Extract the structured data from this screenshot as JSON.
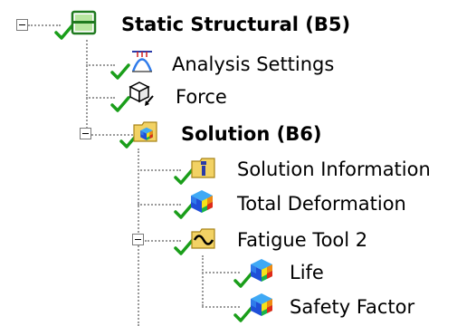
{
  "tree": {
    "static_structural": {
      "label": "Static Structural (B5)",
      "expanded": true,
      "status": "ok"
    },
    "analysis_settings": {
      "label": "Analysis Settings",
      "status": "ok"
    },
    "force": {
      "label": "Force",
      "status": "ok"
    },
    "solution": {
      "label": "Solution (B6)",
      "expanded": true,
      "status": "ok"
    },
    "solution_information": {
      "label": "Solution Information",
      "status": "ok"
    },
    "total_deformation": {
      "label": "Total Deformation",
      "status": "ok"
    },
    "fatigue_tool": {
      "label": "Fatigue Tool 2",
      "expanded": true,
      "status": "ok"
    },
    "life": {
      "label": "Life",
      "status": "ok"
    },
    "safety_factor": {
      "label": "Safety Factor",
      "status": "ok"
    }
  },
  "icons": {
    "check": "green-checkmark-icon",
    "static_structural": "static-structural-icon",
    "analysis_settings": "analysis-settings-icon",
    "force": "force-icon",
    "solution": "solution-folder-icon",
    "solution_information": "solution-information-icon",
    "result": "result-cube-icon",
    "fatigue_tool": "fatigue-tool-icon"
  },
  "colors": {
    "check": "#1a9e1a",
    "folder": "#f2d264",
    "connector": "#9a9a9a"
  }
}
